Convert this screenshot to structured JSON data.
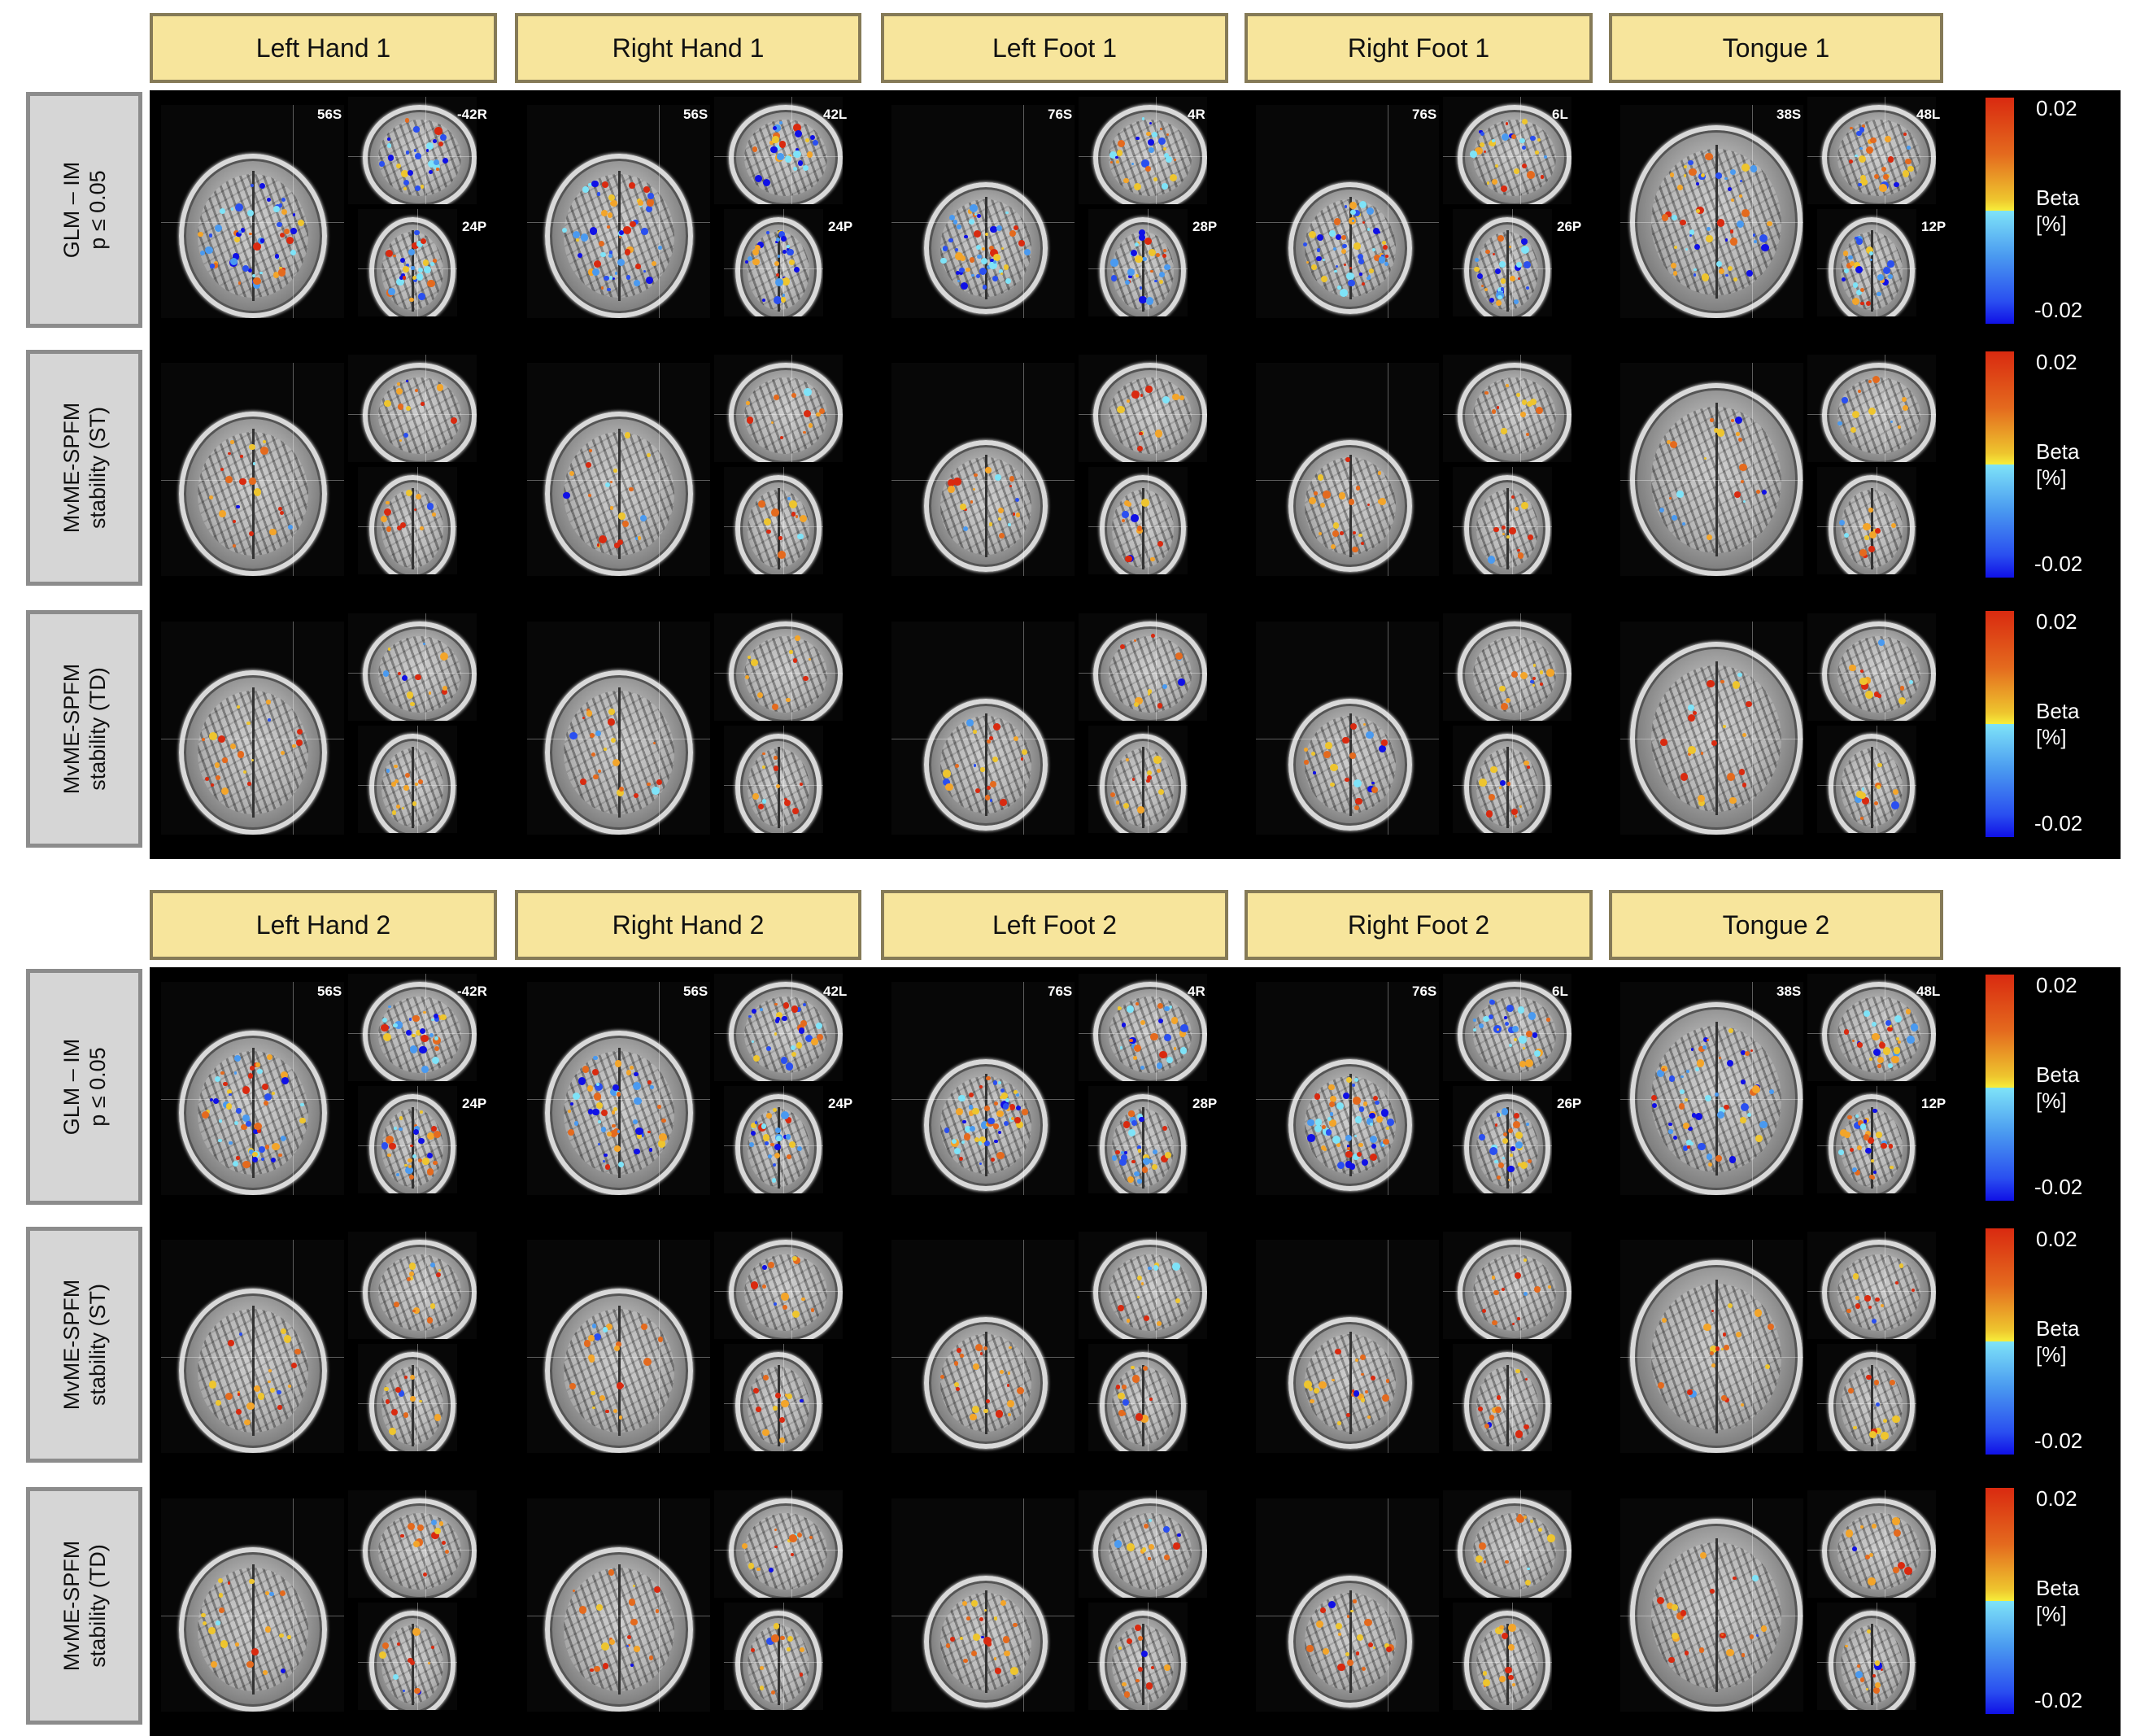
{
  "colors": {
    "header_bg": "#f7e59c",
    "header_border": "#857a57",
    "row_label_bg": "#d6d6d6",
    "row_label_border": "#8c8c8c",
    "panel_bg": "#000000",
    "positive_max": "#d92a10",
    "positive_min": "#f7ef3a",
    "negative_min": "#7ee3f8",
    "negative_max": "#1010e6"
  },
  "row_labels": [
    {
      "line1": "GLM – IM",
      "line2": "p ≤ 0.05"
    },
    {
      "line1": "MvME-SPFM",
      "line2": "stability (ST)"
    },
    {
      "line1": "MvME-SPFM",
      "line2": "stability (TD)"
    }
  ],
  "colorbar": {
    "max_label": "0.02",
    "min_label": "-0.02",
    "title_line1": "Beta",
    "title_line2": "[%]",
    "range": [
      -0.02,
      0.02
    ]
  },
  "panels": [
    {
      "columns": [
        {
          "title": "Left Hand 1",
          "axial": "56S",
          "sagittal": "-42R",
          "coronal": "24P"
        },
        {
          "title": "Right Hand 1",
          "axial": "56S",
          "sagittal": "42L",
          "coronal": "24P"
        },
        {
          "title": "Left Foot 1",
          "axial": "76S",
          "sagittal": "4R",
          "coronal": "28P"
        },
        {
          "title": "Right Foot 1",
          "axial": "76S",
          "sagittal": "6L",
          "coronal": "26P"
        },
        {
          "title": "Tongue 1",
          "axial": "38S",
          "sagittal": "48L",
          "coronal": "12P"
        }
      ]
    },
    {
      "columns": [
        {
          "title": "Left Hand 2",
          "axial": "56S",
          "sagittal": "-42R",
          "coronal": "24P"
        },
        {
          "title": "Right Hand 2",
          "axial": "56S",
          "sagittal": "42L",
          "coronal": "24P"
        },
        {
          "title": "Left Foot 2",
          "axial": "76S",
          "sagittal": "4R",
          "coronal": "28P"
        },
        {
          "title": "Right Foot 2",
          "axial": "76S",
          "sagittal": "6L",
          "coronal": "26P"
        },
        {
          "title": "Tongue 2",
          "axial": "38S",
          "sagittal": "48L",
          "coronal": "12P"
        }
      ]
    }
  ]
}
